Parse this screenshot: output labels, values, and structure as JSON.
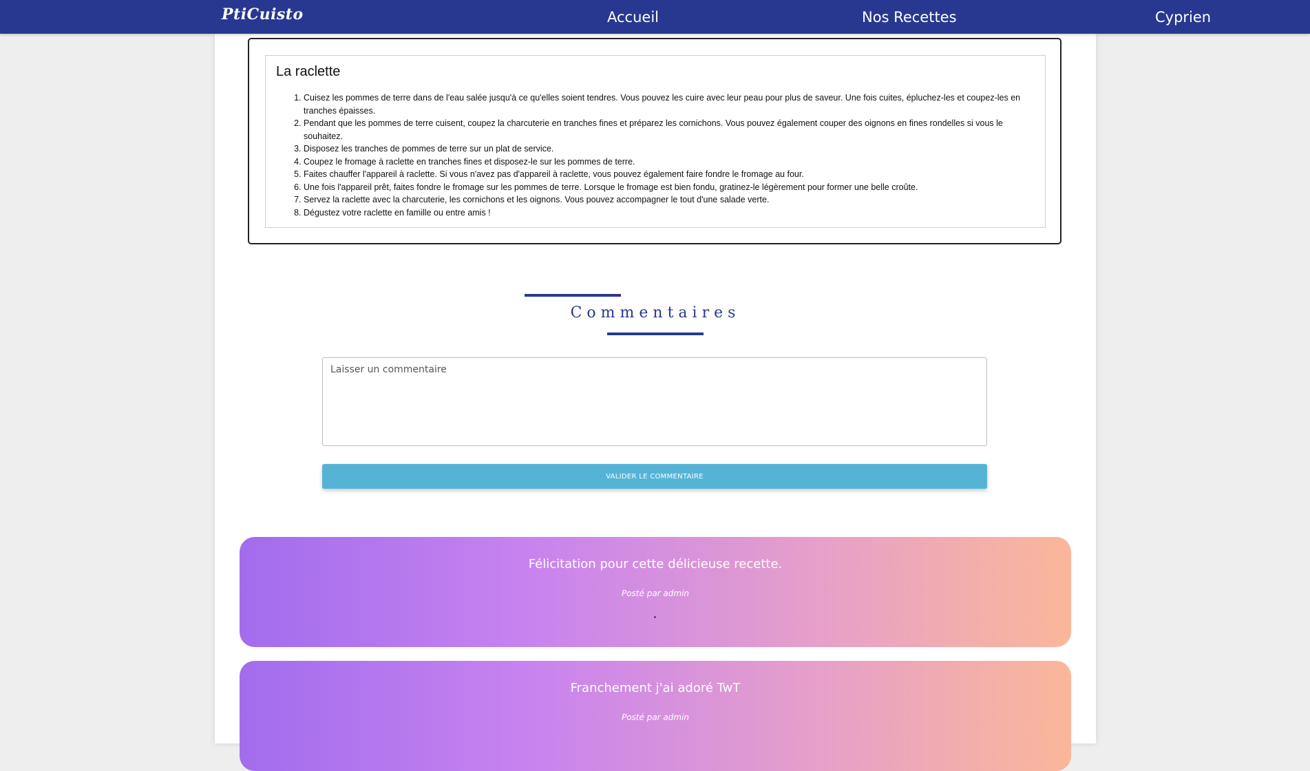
{
  "navbar": {
    "logo": "PtiCuisto",
    "links": [
      "Accueil",
      "Nos Recettes"
    ],
    "user": "Cyprien"
  },
  "recipe": {
    "title": "La raclette",
    "steps": [
      "Cuisez les pommes de terre dans de l'eau salée jusqu'à ce qu'elles soient tendres. Vous pouvez les cuire avec leur peau pour plus de saveur. Une fois cuites, épluchez-les et coupez-les en tranches épaisses.",
      "Pendant que les pommes de terre cuisent, coupez la charcuterie en tranches fines et préparez les cornichons. Vous pouvez également couper des oignons en fines rondelles si vous le souhaitez.",
      "Disposez les tranches de pommes de terre sur un plat de service.",
      "Coupez le fromage à raclette en tranches fines et disposez-le sur les pommes de terre.",
      "Faites chauffer l'appareil à raclette. Si vous n'avez pas d'appareil à raclette, vous pouvez également faire fondre le fromage au four.",
      "Une fois l'appareil prêt, faites fondre le fromage sur les pommes de terre. Lorsque le fromage est bien fondu, gratinez-le légèrement pour former une belle croûte.",
      "Servez la raclette avec la charcuterie, les cornichons et les oignons. Vous pouvez accompagner le tout d'une salade verte.",
      "Dégustez votre raclette en famille ou entre amis !"
    ]
  },
  "comments_section": {
    "heading": "Commentaires",
    "input_placeholder": "Laisser un commentaire",
    "submit_label": "VALIDER LE COMMENTAIRE"
  },
  "comments": [
    {
      "text": "Félicitation pour cette délicieuse recette.",
      "author": "Posté par admin"
    },
    {
      "text": "Franchement j'ai adoré TwT",
      "author": "Posté par admin"
    }
  ],
  "colors": {
    "navbar": "#283891",
    "accent": "#283891",
    "button": "#55b4d6",
    "card_gradient_start": "#a26ced",
    "card_gradient_end": "#fbb799"
  }
}
